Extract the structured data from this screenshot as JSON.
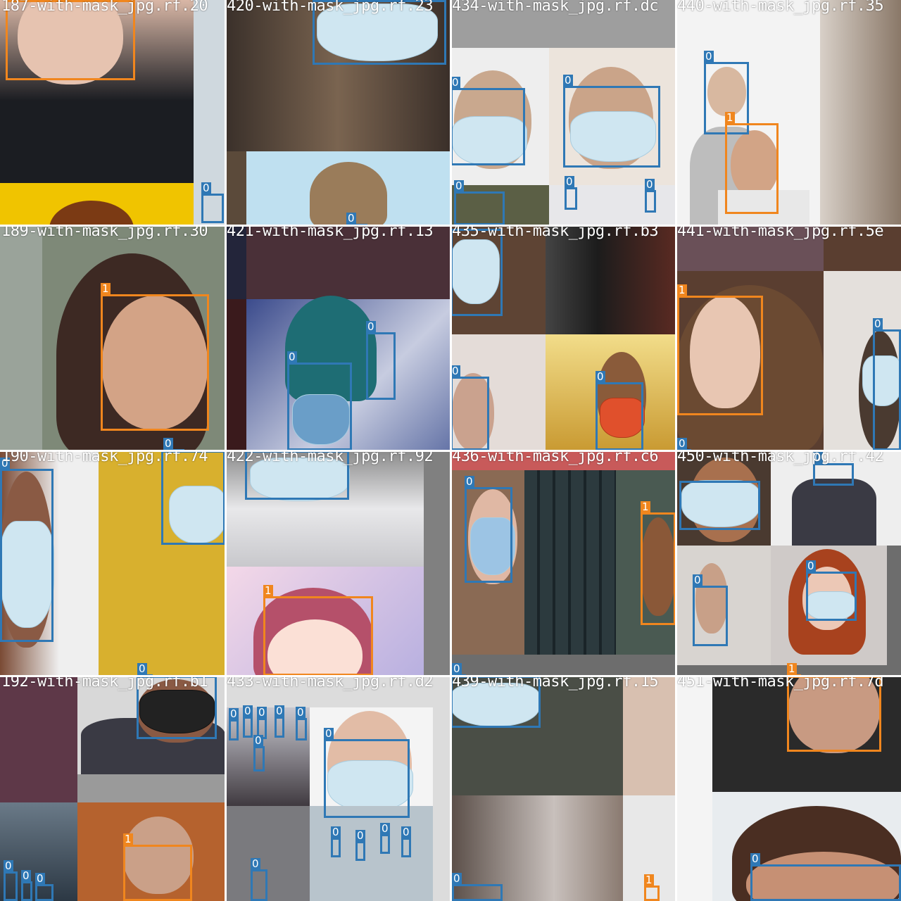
{
  "tiles": [
    {
      "label": "187-with-mask_jpg.rf.20"
    },
    {
      "label": "420-with-mask_jpg.rf.23"
    },
    {
      "label": "434-with-mask_jpg.rf.dc"
    },
    {
      "label": "440-with-mask_jpg.rf.35"
    },
    {
      "label": "189-with-mask_jpg.rf.30"
    },
    {
      "label": "421-with-mask_jpg.rf.13"
    },
    {
      "label": "435-with-mask_jpg.rf.b3"
    },
    {
      "label": "441-with-mask_jpg.rf.5e"
    },
    {
      "label": "190-with-mask_jpg.rf.74"
    },
    {
      "label": "422-with-mask_jpg.rf.92"
    },
    {
      "label": "436-with-mask_jpg.rf.c6"
    },
    {
      "label": "450-with-mask_jpg.rf.42"
    },
    {
      "label": "192-with-mask_jpg.rf.b1"
    },
    {
      "label": "433-with-mask_jpg.rf.d2"
    },
    {
      "label": "439-with-mask_jpg.rf.15"
    },
    {
      "label": "451-with-mask_jpg.rf.7d"
    }
  ],
  "classes": {
    "mask": "0",
    "no_mask": "1"
  },
  "colors": {
    "class0": "#2f78b5",
    "class1": "#f0861e",
    "divider": "#ffffff"
  }
}
